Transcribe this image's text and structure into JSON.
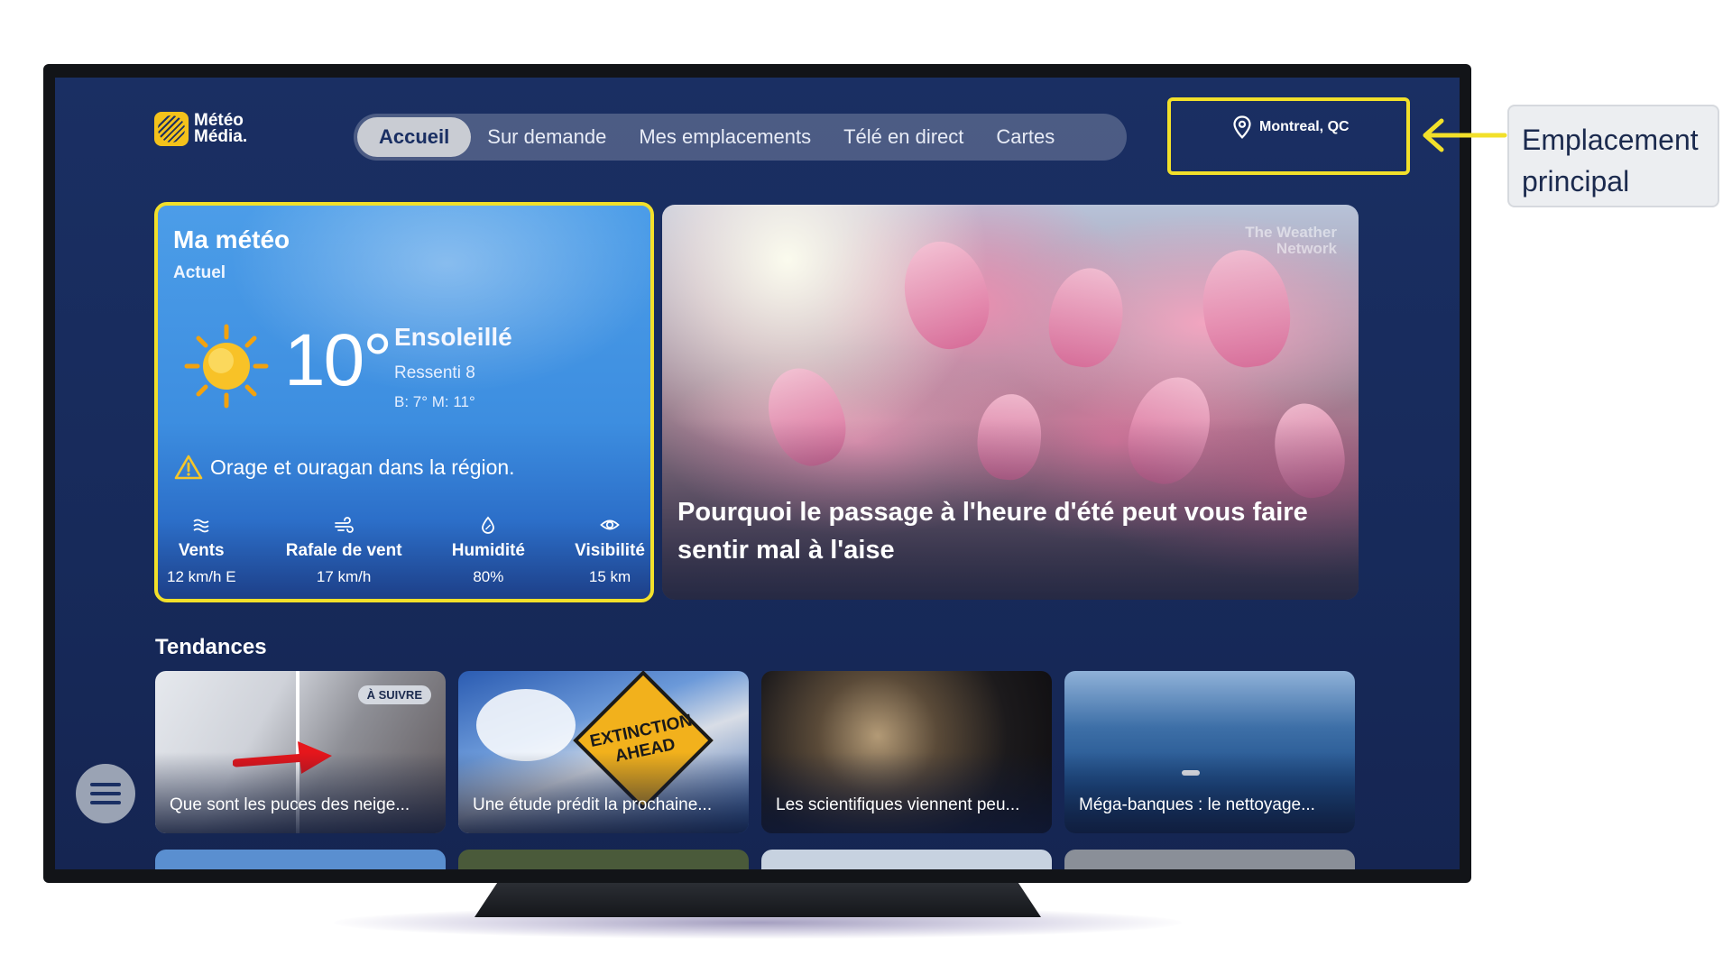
{
  "logo": {
    "line1": "Météo",
    "line2": "Média."
  },
  "nav": {
    "tabs": [
      {
        "label": "Accueil",
        "active": true
      },
      {
        "label": "Sur demande",
        "active": false
      },
      {
        "label": "Mes emplacements",
        "active": false
      },
      {
        "label": "Télé en direct",
        "active": false
      },
      {
        "label": "Cartes",
        "active": false
      }
    ]
  },
  "location": {
    "name": "Montreal, QC",
    "icon": "map-pin-icon"
  },
  "weather": {
    "title": "Ma météo",
    "subtitle": "Actuel",
    "temperature": "10°",
    "condition": "Ensoleillé",
    "feels_like": "Ressenti  8",
    "low_high": "B: 7°  M: 11°",
    "alert": "Orage et ouragan dans la région.",
    "stats": [
      {
        "label": "Vents",
        "value": "12 km/h E",
        "icon": "wind-icon"
      },
      {
        "label": "Rafale de vent",
        "value": "17 km/h",
        "icon": "gust-icon"
      },
      {
        "label": "Humidité",
        "value": "80%",
        "icon": "humidity-icon"
      },
      {
        "label": "Visibilité",
        "value": "15 km",
        "icon": "eye-icon"
      }
    ]
  },
  "hero": {
    "title": "Pourquoi le passage à l'heure d'été peut vous faire sentir mal à l'aise",
    "watermark_line1": "The Weather",
    "watermark_line2": "Network"
  },
  "trending": {
    "title": "Tendances",
    "cards": [
      {
        "title": "Que sont les puces des neige...",
        "badge": "À SUIVRE"
      },
      {
        "title": "Une étude prédit la prochaine...",
        "sign_line1": "EXTINCTION",
        "sign_line2": "AHEAD"
      },
      {
        "title": "Les scientifiques viennent peu..."
      },
      {
        "title": "Méga-banques : le nettoyage..."
      }
    ]
  },
  "callout": {
    "line1": "Emplacement",
    "line2": "principal"
  },
  "colors": {
    "highlight": "#f2e02a",
    "background": "#1a2f63",
    "accent": "#f4c21b"
  }
}
